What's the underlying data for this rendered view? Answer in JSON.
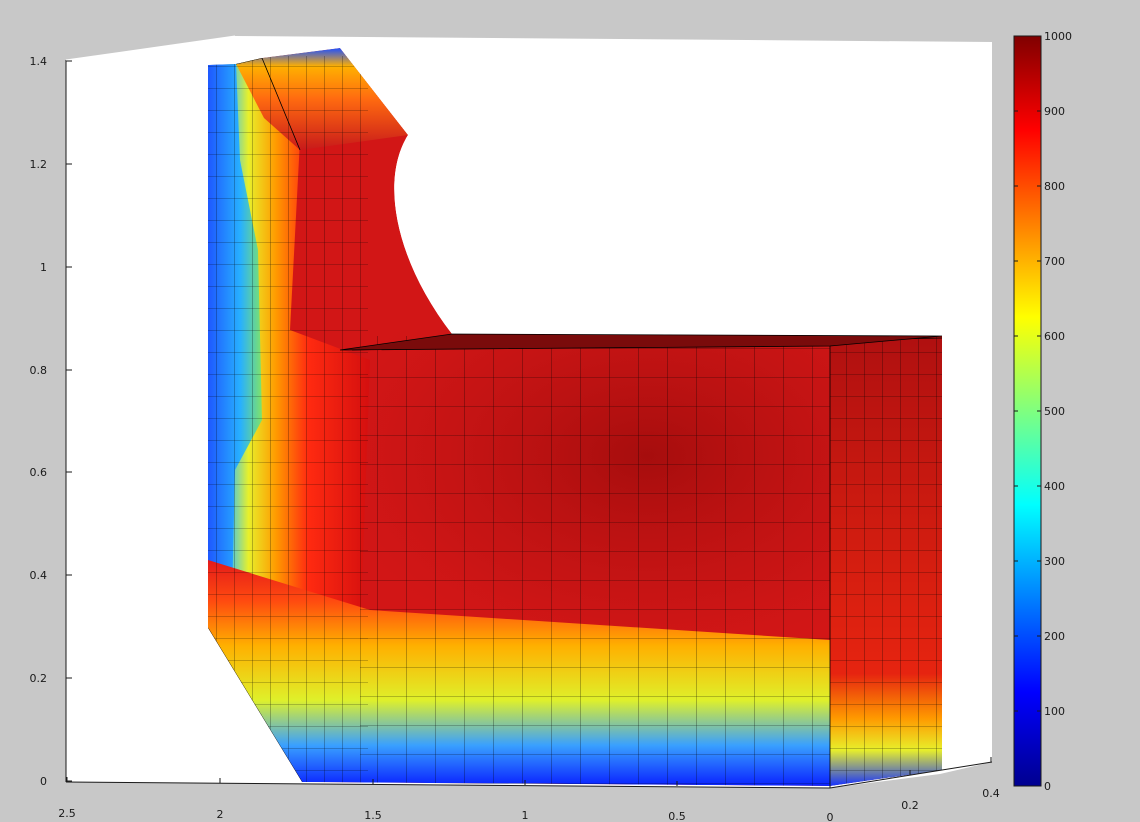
{
  "chart_data": {
    "type": "heatmap",
    "title": "",
    "xlabel": "",
    "ylabel": "",
    "zlabel": "",
    "x_ticks": [
      "2.5",
      "2",
      "1.5",
      "1",
      "0.5",
      "0"
    ],
    "y_ticks": [
      "0.2",
      "0.4"
    ],
    "z_ticks": [
      "0",
      "0.2",
      "0.4",
      "0.6",
      "0.8",
      "1",
      "1.2",
      "1.4"
    ],
    "colorbar_ticks": [
      "0",
      "100",
      "200",
      "300",
      "400",
      "500",
      "600",
      "700",
      "800",
      "900",
      "1000"
    ],
    "xlim": [
      0,
      2.5
    ],
    "ylim": [
      0,
      0.4
    ],
    "zlim": [
      0,
      1.4
    ],
    "clim": [
      0,
      1000
    ],
    "colormap": "jet",
    "grid": false,
    "colorbar_position": "right",
    "mesh_edges": true
  }
}
